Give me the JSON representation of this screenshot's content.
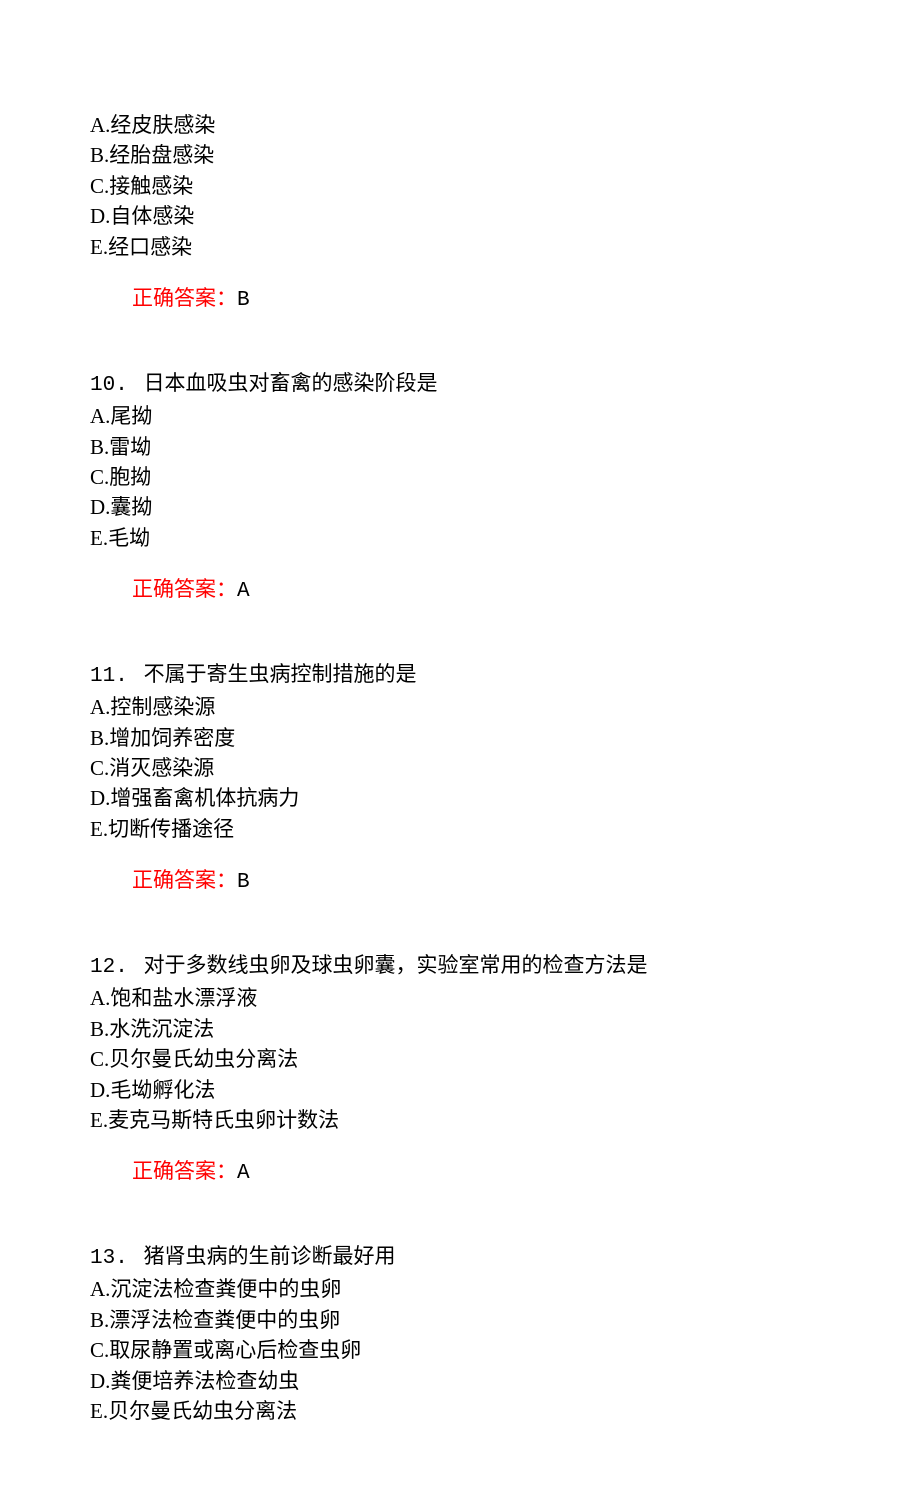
{
  "q9_remainder": {
    "options": [
      "A.经皮肤感染",
      "B.经胎盘感染",
      "C.接触感染",
      "D.自体感染",
      "E.经口感染"
    ],
    "answer_label": "正确答案：",
    "answer_value": "B"
  },
  "q10": {
    "number": "10.",
    "text": "日本血吸虫对畜禽的感染阶段是",
    "options": [
      "A.尾拗",
      "B.雷坳",
      "C.胞拗",
      "D.囊拗",
      "E.毛坳"
    ],
    "answer_label": "正确答案：",
    "answer_value": "A"
  },
  "q11": {
    "number": "11.",
    "text": "不属于寄生虫病控制措施的是",
    "options": [
      "A.控制感染源",
      "B.增加饲养密度",
      "C.消灭感染源",
      "D.增强畜禽机体抗病力",
      "E.切断传播途径"
    ],
    "answer_label": "正确答案：",
    "answer_value": "B"
  },
  "q12": {
    "number": "12.",
    "text": "对于多数线虫卵及球虫卵囊，实验室常用的检查方法是",
    "options": [
      "A.饱和盐水漂浮液",
      "B.水洗沉淀法",
      "C.贝尔曼氏幼虫分离法",
      "D.毛坳孵化法",
      "E.麦克马斯特氏虫卵计数法"
    ],
    "answer_label": "正确答案：",
    "answer_value": "A"
  },
  "q13": {
    "number": "13.",
    "text": "猪肾虫病的生前诊断最好用",
    "options": [
      "A.沉淀法检查粪便中的虫卵",
      "B.漂浮法检查粪便中的虫卵",
      "C.取尿静置或离心后检查虫卵",
      "D.粪便培养法检查幼虫",
      "E.贝尔曼氏幼虫分离法"
    ]
  }
}
